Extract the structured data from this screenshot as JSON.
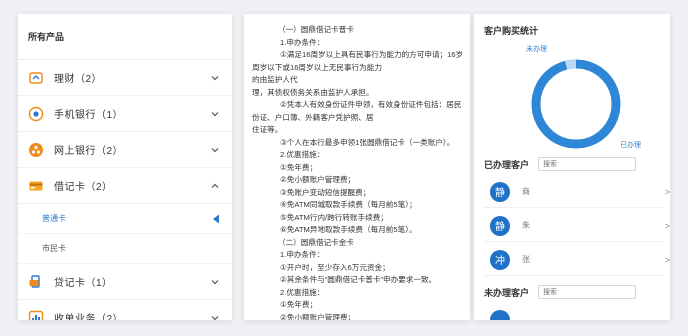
{
  "sidebar": {
    "title": "所有产品",
    "items": [
      {
        "label": "理财（2）",
        "icon": "wallet-icon",
        "chev": "down"
      },
      {
        "label": "手机银行（1）",
        "icon": "mobile-bank-icon",
        "chev": "down"
      },
      {
        "label": "网上银行（2）",
        "icon": "online-bank-icon",
        "chev": "down"
      },
      {
        "label": "借记卡（2）",
        "icon": "debit-card-icon",
        "chev": "up"
      },
      {
        "label": "贷记卡（1）",
        "icon": "credit-card-icon",
        "chev": "down"
      },
      {
        "label": "收单业务（2）",
        "icon": "acquiring-chart-icon",
        "chev": "down"
      }
    ],
    "subitems": [
      {
        "label": "普通卡",
        "active": true
      },
      {
        "label": "市民卡",
        "active": false
      }
    ]
  },
  "content": {
    "lines": [
      {
        "t": "（一）圆鼎借记卡普卡",
        "c": "ind2"
      },
      {
        "t": "1.申办条件：",
        "c": "ind1"
      },
      {
        "t": "①满足16周岁以上具有民事行为能力的方可申请；16岁",
        "c": "ind1"
      },
      {
        "t": "周岁以下或16周岁以上无民事行为能力",
        "c": ""
      },
      {
        "t": "的由监护人代",
        "c": ""
      },
      {
        "t": "理，其债权债务关系由监护人承担。",
        "c": ""
      },
      {
        "t": "②凭本人有效身份证件申领，有效身份证件包括：居民身",
        "c": "ind1"
      },
      {
        "t": "份证、户口簿、外籍客户凭护照、居",
        "c": ""
      },
      {
        "t": "住证等。",
        "c": ""
      },
      {
        "t": "③个人在本行最多申领1张圆鼎借记卡（一类账户）。",
        "c": "ind1"
      },
      {
        "t": "2.优惠措施：",
        "c": "ind1"
      },
      {
        "t": "①免年费；",
        "c": "ind1"
      },
      {
        "t": "②免小额账户管理费；",
        "c": "ind1"
      },
      {
        "t": "③免账户变动短信提醒费；",
        "c": "ind1"
      },
      {
        "t": "④免ATM同城取款手续费（每月前5笔）；",
        "c": "ind1"
      },
      {
        "t": "⑤免ATM行内/跨行转账手续费；",
        "c": "ind1"
      },
      {
        "t": "⑥免ATM异地取款手续费（每月前5笔）。",
        "c": "ind1"
      },
      {
        "t": "（二）圆鼎借记卡金卡",
        "c": "ind2"
      },
      {
        "t": "1.申办条件：",
        "c": "ind1"
      },
      {
        "t": "①开户时，至少存入6万元资金；",
        "c": "ind1"
      },
      {
        "t": "②其余条件与“圆鼎借记卡普卡”申办要求一致。",
        "c": "ind1"
      },
      {
        "t": "2.优惠措施：",
        "c": "ind1"
      },
      {
        "t": "①免年费；",
        "c": "ind1"
      },
      {
        "t": "②免小额账户管理费；",
        "c": "ind1"
      }
    ]
  },
  "stats": {
    "title": "客户购买统计",
    "label_unpurchased": "未办理",
    "label_purchased": "已办理",
    "unpurchased_share": 0.04,
    "colors": {
      "purchased": "#2e86d6",
      "unpurchased": "#b9d8f3"
    }
  },
  "done": {
    "title": "已办理客户",
    "search_placeholder": "搜索",
    "customers": [
      {
        "avatar": "静",
        "name": "商",
        "chev": ">"
      },
      {
        "avatar": "静",
        "name": "朱",
        "chev": ">"
      },
      {
        "avatar": "冲",
        "name": "张",
        "chev": ">"
      }
    ]
  },
  "notdone": {
    "title": "未办理客户",
    "search_placeholder": "搜索"
  }
}
